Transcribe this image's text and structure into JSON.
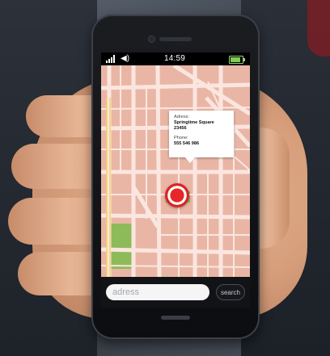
{
  "statusbar": {
    "time": "14:59",
    "signal_icon": "signal-icon",
    "volume_icon": "volume-icon",
    "battery_icon": "battery-icon",
    "battery_color": "#7dcf55"
  },
  "map": {
    "block_color": "#e9b6a6",
    "road_color": "#fbe6df",
    "park_color": "#8dbb5a",
    "marker_icon": "location-pin-icon",
    "marker_color": "#e52727",
    "info_popup": {
      "address_label": "Adress:",
      "address_line1": "Springtime Square",
      "address_line2": "23456",
      "phone_label": "Phone:",
      "phone_value": "555 546 986"
    }
  },
  "search": {
    "placeholder": "adress",
    "button_label": "search"
  }
}
